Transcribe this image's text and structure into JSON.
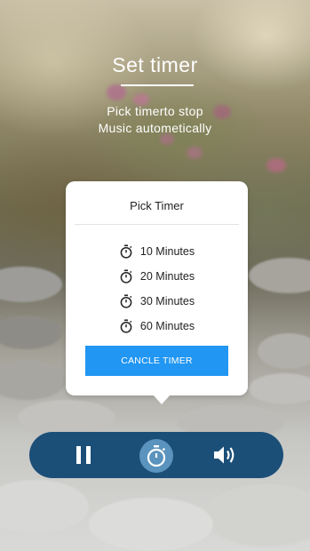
{
  "header": {
    "title": "Set timer",
    "subtitle_line1": "Pick timerto stop",
    "subtitle_line2": "Music autometically"
  },
  "popup": {
    "title": "Pick Timer",
    "options": [
      {
        "label": "10 Minutes",
        "icon": "stopwatch-icon"
      },
      {
        "label": "20 Minutes",
        "icon": "stopwatch-icon"
      },
      {
        "label": "30 Minutes",
        "icon": "stopwatch-icon"
      },
      {
        "label": "60 Minutes",
        "icon": "stopwatch-icon"
      }
    ],
    "cancel_label": "CANCLE TIMER"
  },
  "player": {
    "buttons": [
      "pause-icon",
      "stopwatch-icon",
      "volume-icon"
    ]
  },
  "colors": {
    "accent": "#2196f3",
    "control_bar": "#1b4f78",
    "timer_button": "#5a93bd",
    "text_light": "#ffffff"
  }
}
